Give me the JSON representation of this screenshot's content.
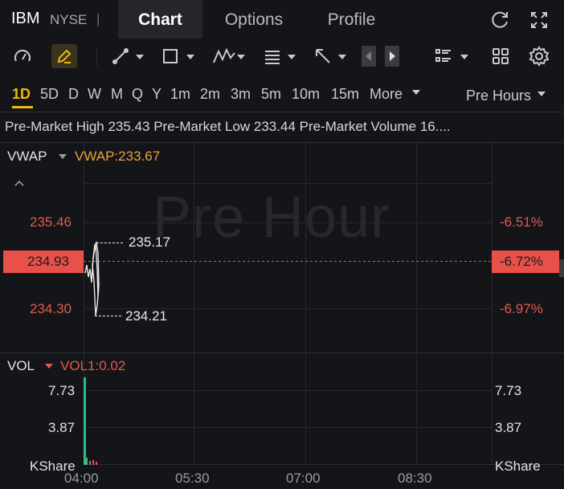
{
  "header": {
    "ticker": "IBM",
    "exchange": "NYSE",
    "separator": "|",
    "tabs": [
      "Chart",
      "Options",
      "Profile"
    ]
  },
  "periods": {
    "items": [
      "1D",
      "5D",
      "D",
      "W",
      "M",
      "Q",
      "Y",
      "1m",
      "2m",
      "3m",
      "5m",
      "10m",
      "15m"
    ],
    "more": "More",
    "session": "Pre Hours"
  },
  "info_line": "Pre-Market High 235.43 Pre-Market Low 233.44 Pre-Market Volume 16....",
  "price_panel": {
    "indicator": "VWAP",
    "indicator_value": "VWAP:233.67",
    "watermark": "Pre Hour",
    "left_ticks": [
      "235.46",
      "234.30"
    ],
    "right_ticks": [
      "-6.51%",
      "-6.97%"
    ],
    "current_price": "234.93",
    "current_pct": "-6.72%",
    "high_label": "235.17",
    "low_label": "234.21"
  },
  "volume_panel": {
    "indicator": "VOL",
    "indicator_value": "VOL1:0.02",
    "left_ticks": [
      "7.73",
      "3.87",
      "KShare"
    ],
    "right_ticks": [
      "7.73",
      "3.87",
      "KShare"
    ]
  },
  "time_axis": [
    "04:00",
    "05:30",
    "07:00",
    "08:30"
  ],
  "colors": {
    "background": "#141518",
    "accent": "#f0b90b",
    "down_red": "#e05a52",
    "price_badge": "#e8504a",
    "volume_green": "#2ebd85"
  }
}
